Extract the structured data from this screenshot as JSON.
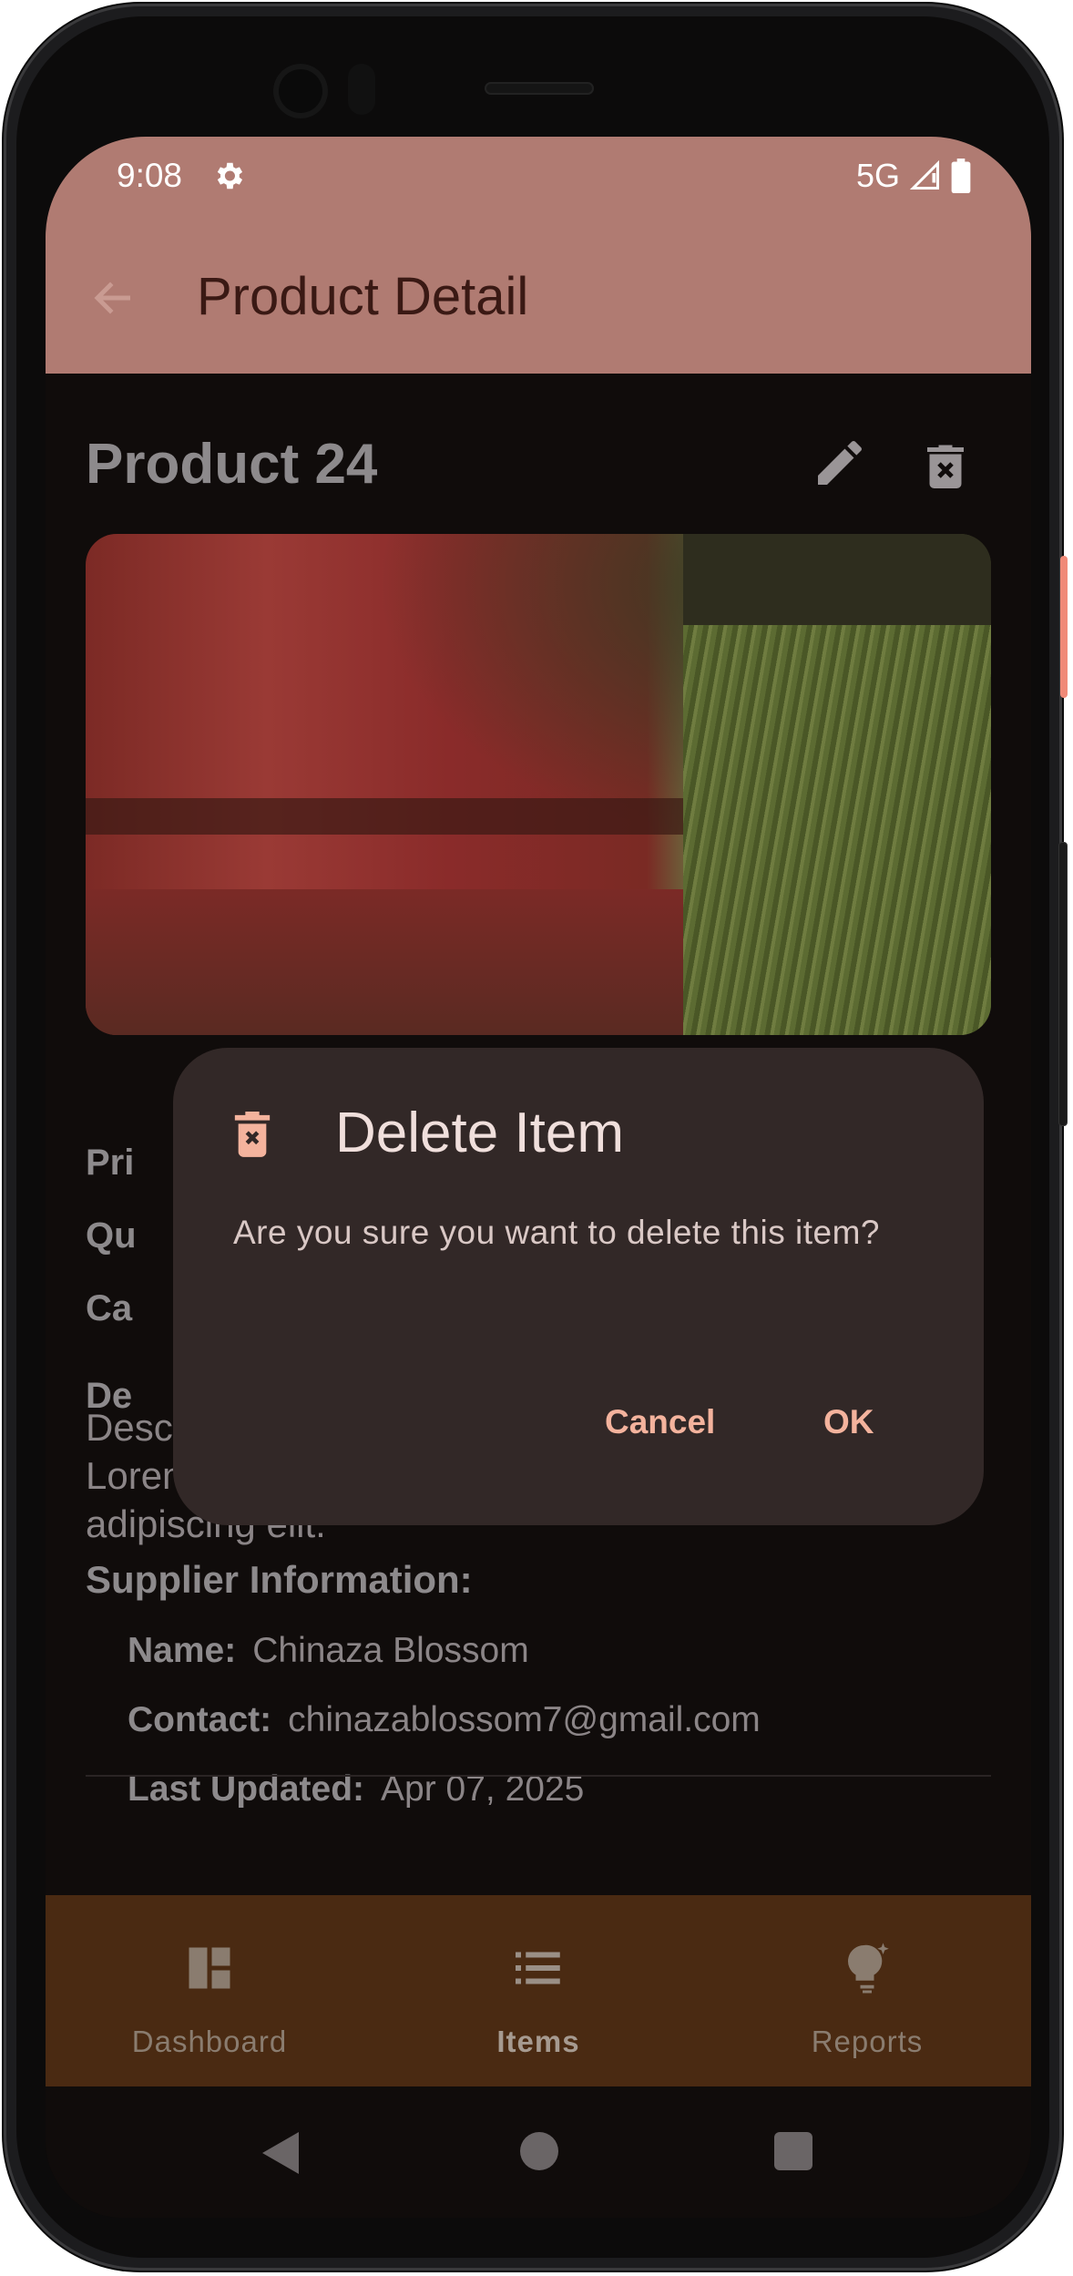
{
  "status_bar": {
    "time": "9:08",
    "network": "5G"
  },
  "app_bar": {
    "title": "Product Detail"
  },
  "product": {
    "title": "Product 24",
    "price_label": "Pri",
    "quantity_label": "Qu",
    "category_label": "Ca",
    "description_label": "De",
    "description": "Description for item 24\nLorem ipsum dolor sit amet, consectetur adipiscing elit."
  },
  "supplier": {
    "heading": "Supplier Information:",
    "name_label": "Name:",
    "name_value": "Chinaza Blossom",
    "contact_label": "Contact:",
    "contact_value": "chinazablossom7@gmail.com",
    "updated_label": "Last Updated:",
    "updated_value": "Apr 07, 2025"
  },
  "bottom_nav": {
    "items": [
      {
        "label": "Dashboard",
        "icon": "dashboard-icon",
        "active": false
      },
      {
        "label": "Items",
        "icon": "list-icon",
        "active": true
      },
      {
        "label": "Reports",
        "icon": "lightbulb-icon",
        "active": false
      }
    ]
  },
  "dialog": {
    "title": "Delete Item",
    "message": "Are you sure you want to delete this item?",
    "cancel_label": "Cancel",
    "ok_label": "OK"
  },
  "colors": {
    "app_bar": "#b07b72",
    "background": "#100c0b",
    "dialog": "#322827",
    "accent": "#f4b39d",
    "nav_bar": "#4a2a12"
  }
}
